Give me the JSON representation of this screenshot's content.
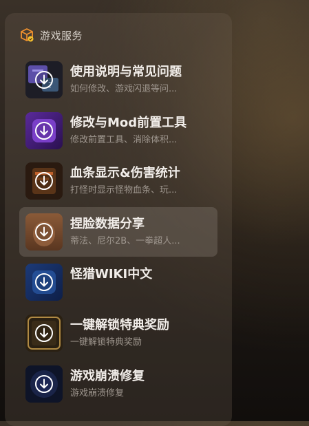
{
  "panel": {
    "title": "游戏服务",
    "header_icon": "game-service-cube-icon",
    "accent_color": "#f2922e"
  },
  "items": [
    {
      "title": "使用说明与常见问题",
      "subtitle": "如何修改、游戏闪退等问...",
      "thumb_icon": "help-thumbnail-icon",
      "action_icon": "download-icon",
      "selected": false
    },
    {
      "title": "修改与Mod前置工具",
      "subtitle": "修改前置工具、消除体积...",
      "thumb_icon": "mod-tool-thumbnail-icon",
      "action_icon": "download-icon",
      "selected": false
    },
    {
      "title": "血条显示&伤害统计",
      "subtitle": "打怪时显示怪物血条、玩...",
      "thumb_icon": "health-bar-thumbnail-icon",
      "action_icon": "download-icon",
      "selected": false
    },
    {
      "title": "捏脸数据分享",
      "subtitle": "蒂法、尼尔2B、一拳超人...",
      "thumb_icon": "face-data-thumbnail-icon",
      "action_icon": "download-icon",
      "selected": true
    },
    {
      "title": "怪猎WIKI中文",
      "subtitle": "",
      "thumb_icon": "wiki-thumbnail-icon",
      "action_icon": "download-icon",
      "selected": false
    },
    {
      "title": "一键解锁特典奖励",
      "subtitle": "一键解锁特典奖励",
      "thumb_icon": "unlock-reward-thumbnail-icon",
      "action_icon": "download-icon",
      "selected": false
    },
    {
      "title": "游戏崩溃修复",
      "subtitle": "游戏崩溃修复",
      "thumb_icon": "crash-fix-thumbnail-icon",
      "action_icon": "download-icon",
      "selected": false
    }
  ]
}
